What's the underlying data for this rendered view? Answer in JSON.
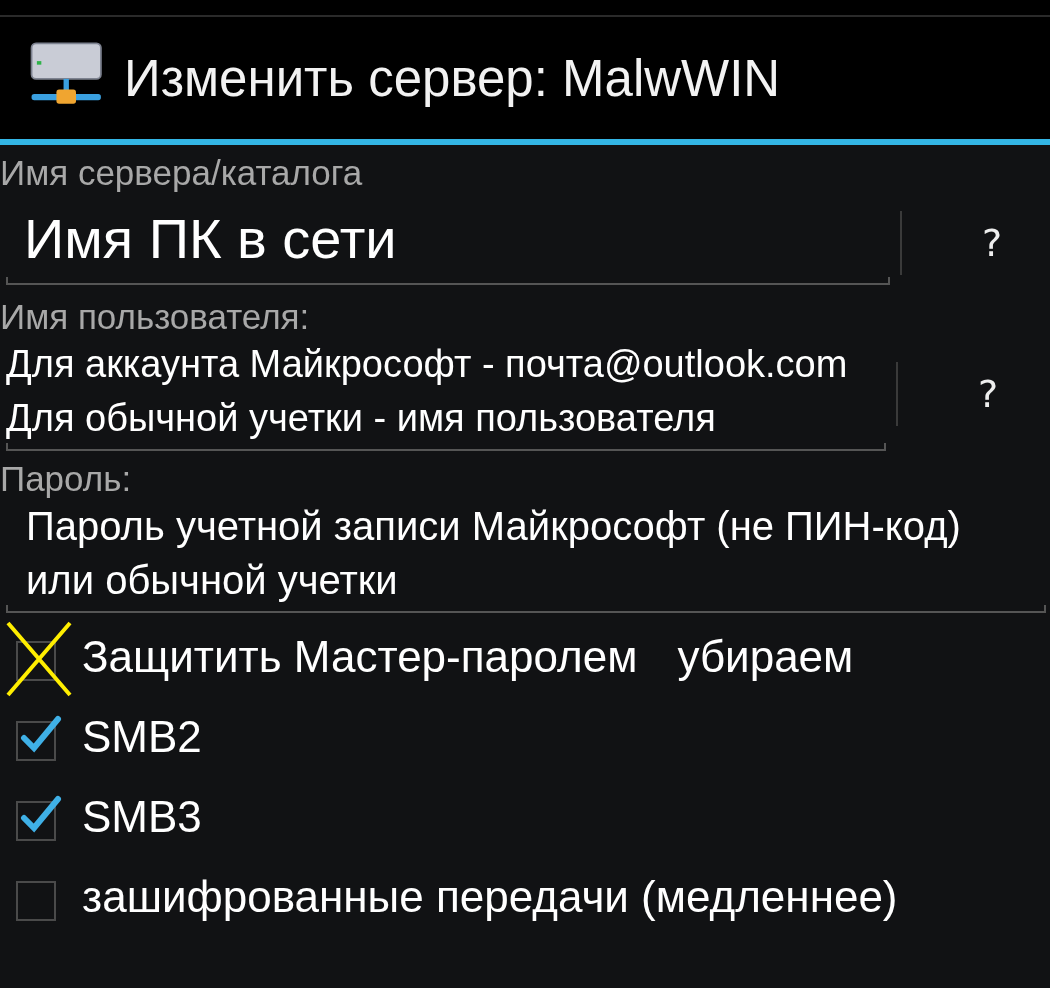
{
  "dialog": {
    "title": "Изменить сервер: MalwWIN"
  },
  "fields": [
    {
      "kind": "single",
      "label": "Имя сервера/каталога",
      "value": "Имя ПК в сети",
      "help": "?"
    },
    {
      "kind": "multi",
      "label": "Имя пользователя:",
      "value": "Для аккаунта Майкрософт - почта@outlook.com\nДля обычной учетки - имя пользователя",
      "help": "?"
    },
    {
      "kind": "password",
      "label": "Пароль:",
      "value": "Пароль учетной записи Майкрософт (не ПИН-код) или обычной учетки"
    }
  ],
  "options": [
    {
      "label": "Защитить Мастер-паролем",
      "checked": false,
      "crossed_out": true,
      "note": "убираем"
    },
    {
      "label": "SMB2",
      "checked": true,
      "crossed_out": false
    },
    {
      "label": "SMB3",
      "checked": true,
      "crossed_out": false
    },
    {
      "label": "зашифрованные передачи (медленнее)",
      "checked": false,
      "crossed_out": false
    }
  ]
}
